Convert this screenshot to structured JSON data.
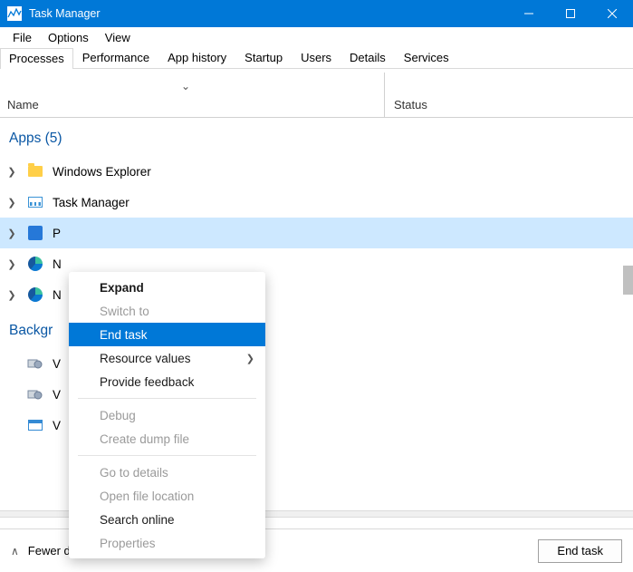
{
  "window": {
    "title": "Task Manager"
  },
  "menubar": {
    "items": [
      "File",
      "Options",
      "View"
    ]
  },
  "tabs": {
    "items": [
      "Processes",
      "Performance",
      "App history",
      "Startup",
      "Users",
      "Details",
      "Services"
    ],
    "active_index": 0
  },
  "columns": {
    "name": "Name",
    "status": "Status"
  },
  "groups": {
    "apps": {
      "label": "Apps (5)"
    },
    "background": {
      "label": "Backgr"
    }
  },
  "processes": {
    "apps": [
      {
        "name": "Windows Explorer",
        "icon": "folder"
      },
      {
        "name": "Task Manager",
        "icon": "tm"
      },
      {
        "name": "P",
        "icon": "blue",
        "selected": true
      },
      {
        "name": "N",
        "icon": "edge"
      },
      {
        "name": "N",
        "icon": "edge"
      }
    ],
    "background": [
      {
        "name": "V",
        "icon": "svc"
      },
      {
        "name": "V",
        "icon": "svc"
      },
      {
        "name": "V",
        "icon": "win"
      }
    ]
  },
  "context_menu": {
    "items": [
      {
        "label": "Expand",
        "bold": true
      },
      {
        "label": "Switch to",
        "disabled": true
      },
      {
        "label": "End task",
        "hover": true
      },
      {
        "label": "Resource values",
        "submenu": true
      },
      {
        "label": "Provide feedback"
      },
      {
        "sep": true
      },
      {
        "label": "Debug",
        "disabled": true
      },
      {
        "label": "Create dump file",
        "disabled": true
      },
      {
        "sep": true
      },
      {
        "label": "Go to details",
        "disabled": true
      },
      {
        "label": "Open file location",
        "disabled": true
      },
      {
        "label": "Search online"
      },
      {
        "label": "Properties",
        "disabled": true
      }
    ]
  },
  "footer": {
    "fewer_details": "Fewer details",
    "end_task": "End task"
  }
}
